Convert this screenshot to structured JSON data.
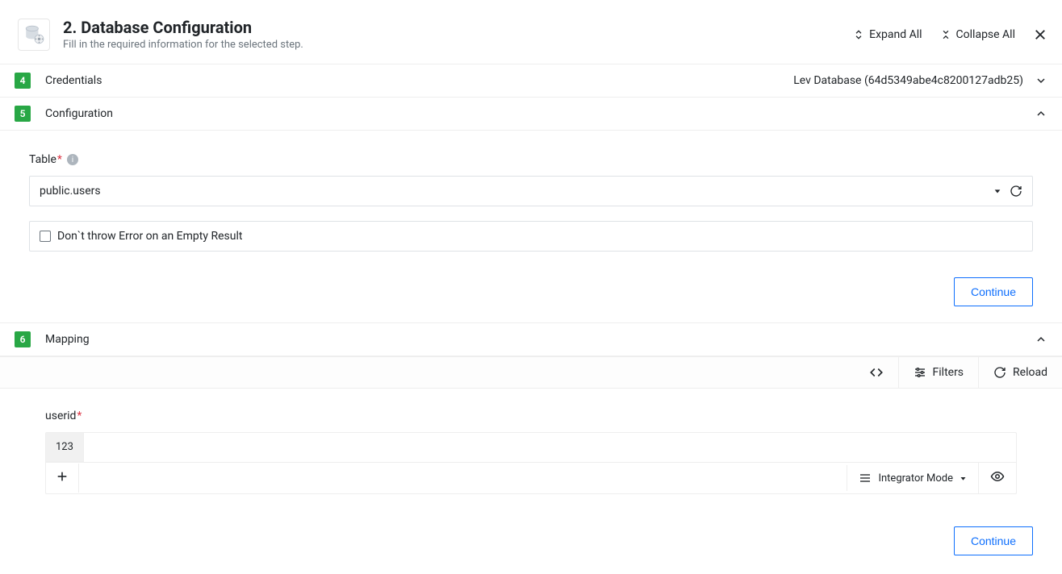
{
  "header": {
    "title": "2. Database Configuration",
    "subtitle": "Fill in the required information for the selected step.",
    "expand_all": "Expand All",
    "collapse_all": "Collapse All"
  },
  "sections": {
    "credentials": {
      "num": "4",
      "title": "Credentials",
      "right": "Lev Database (64d5349abe4c8200127adb25)"
    },
    "configuration": {
      "num": "5",
      "title": "Configuration",
      "table_label": "Table",
      "table_value": "public.users",
      "checkbox_label": "Don`t throw Error on an Empty Result",
      "continue": "Continue"
    },
    "mapping": {
      "num": "6",
      "title": "Mapping",
      "filters": "Filters",
      "reload": "Reload",
      "userid_label": "userid",
      "userid_pill": "123",
      "integrator_mode": "Integrator Mode",
      "continue": "Continue"
    }
  }
}
